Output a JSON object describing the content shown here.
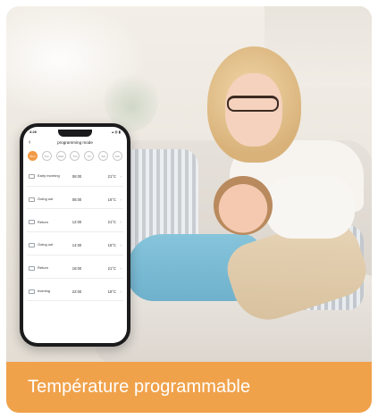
{
  "phone": {
    "status_time": "4:26",
    "status_right": "▴ ◍ ▮",
    "back": "‹",
    "title": "programming mode",
    "days": [
      "Mon",
      "Tue",
      "Wed",
      "Thu",
      "Fri",
      "Sat",
      "Sun"
    ],
    "active_day_index": 0,
    "schedule": [
      {
        "name": "Early morning",
        "time": "06:00",
        "temp": "21°C",
        "arrow": "›"
      },
      {
        "name": "Going out",
        "time": "08:00",
        "temp": "16°C",
        "arrow": "›"
      },
      {
        "name": "Return",
        "time": "12:00",
        "temp": "21°C",
        "arrow": "›"
      },
      {
        "name": "Going out",
        "time": "14:00",
        "temp": "16°C",
        "arrow": "›"
      },
      {
        "name": "Return",
        "time": "18:00",
        "temp": "21°C",
        "arrow": "›"
      },
      {
        "name": "evening",
        "time": "22:00",
        "temp": "18°C",
        "arrow": "›"
      }
    ]
  },
  "banner": {
    "text": "Température programmable"
  },
  "colors": {
    "accent": "#f0a24b",
    "day_active": "#f29a45"
  }
}
